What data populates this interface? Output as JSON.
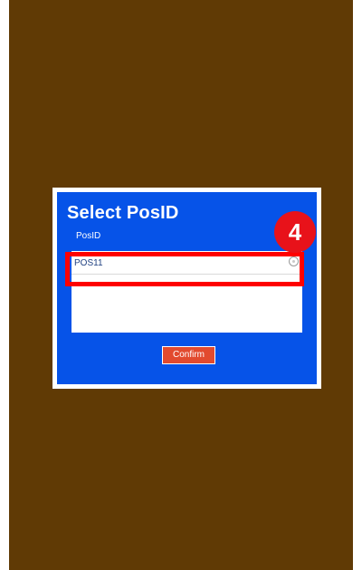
{
  "dialog": {
    "title": "Select PosID",
    "field_label": "PosID",
    "options": [
      {
        "label": "POS11",
        "selected": false
      }
    ],
    "confirm_label": "Confirm"
  },
  "annotation": {
    "step_number": "4",
    "highlight_color": "#ff0000"
  },
  "colors": {
    "background": "#603a05",
    "dialog": "#0653e8",
    "confirm_button": "#e24a2e"
  }
}
